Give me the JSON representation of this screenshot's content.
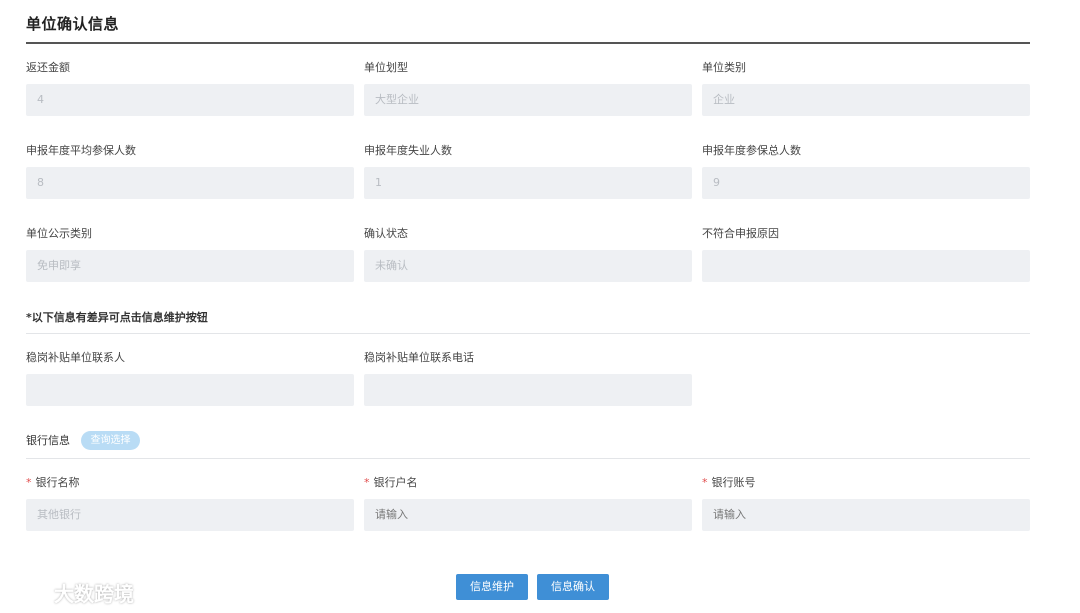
{
  "header": {
    "title": "单位确认信息"
  },
  "fields": [
    {
      "label": "返还金额",
      "value": "4"
    },
    {
      "label": "单位划型",
      "value": "大型企业"
    },
    {
      "label": "单位类别",
      "value": "企业"
    },
    {
      "label": "申报年度平均参保人数",
      "value": "8"
    },
    {
      "label": "申报年度失业人数",
      "value": "1"
    },
    {
      "label": "申报年度参保总人数",
      "value": "9"
    },
    {
      "label": "单位公示类别",
      "value": "免申即享"
    },
    {
      "label": "确认状态",
      "value": "未确认"
    },
    {
      "label": "不符合申报原因",
      "value": ""
    }
  ],
  "note": "*以下信息有差异可点击信息维护按钮",
  "contact_fields": [
    {
      "label": "稳岗补贴单位联系人",
      "value": ""
    },
    {
      "label": "稳岗补贴单位联系电话",
      "value": ""
    }
  ],
  "bank": {
    "label": "银行信息",
    "select_button": "查询选择",
    "fields": [
      {
        "label": "银行名称",
        "value": "其他银行"
      },
      {
        "label": "银行户名",
        "placeholder": "请输入"
      },
      {
        "label": "银行账号",
        "placeholder": "请输入"
      }
    ]
  },
  "buttons": {
    "maintain": "信息维护",
    "confirm": "信息确认"
  },
  "watermark": "大数跨境",
  "colors": {
    "primary_button": "#3f8fd6",
    "pill": "#b9dcf5",
    "field_bg": "#eef0f3",
    "required": "#e04c4c"
  }
}
